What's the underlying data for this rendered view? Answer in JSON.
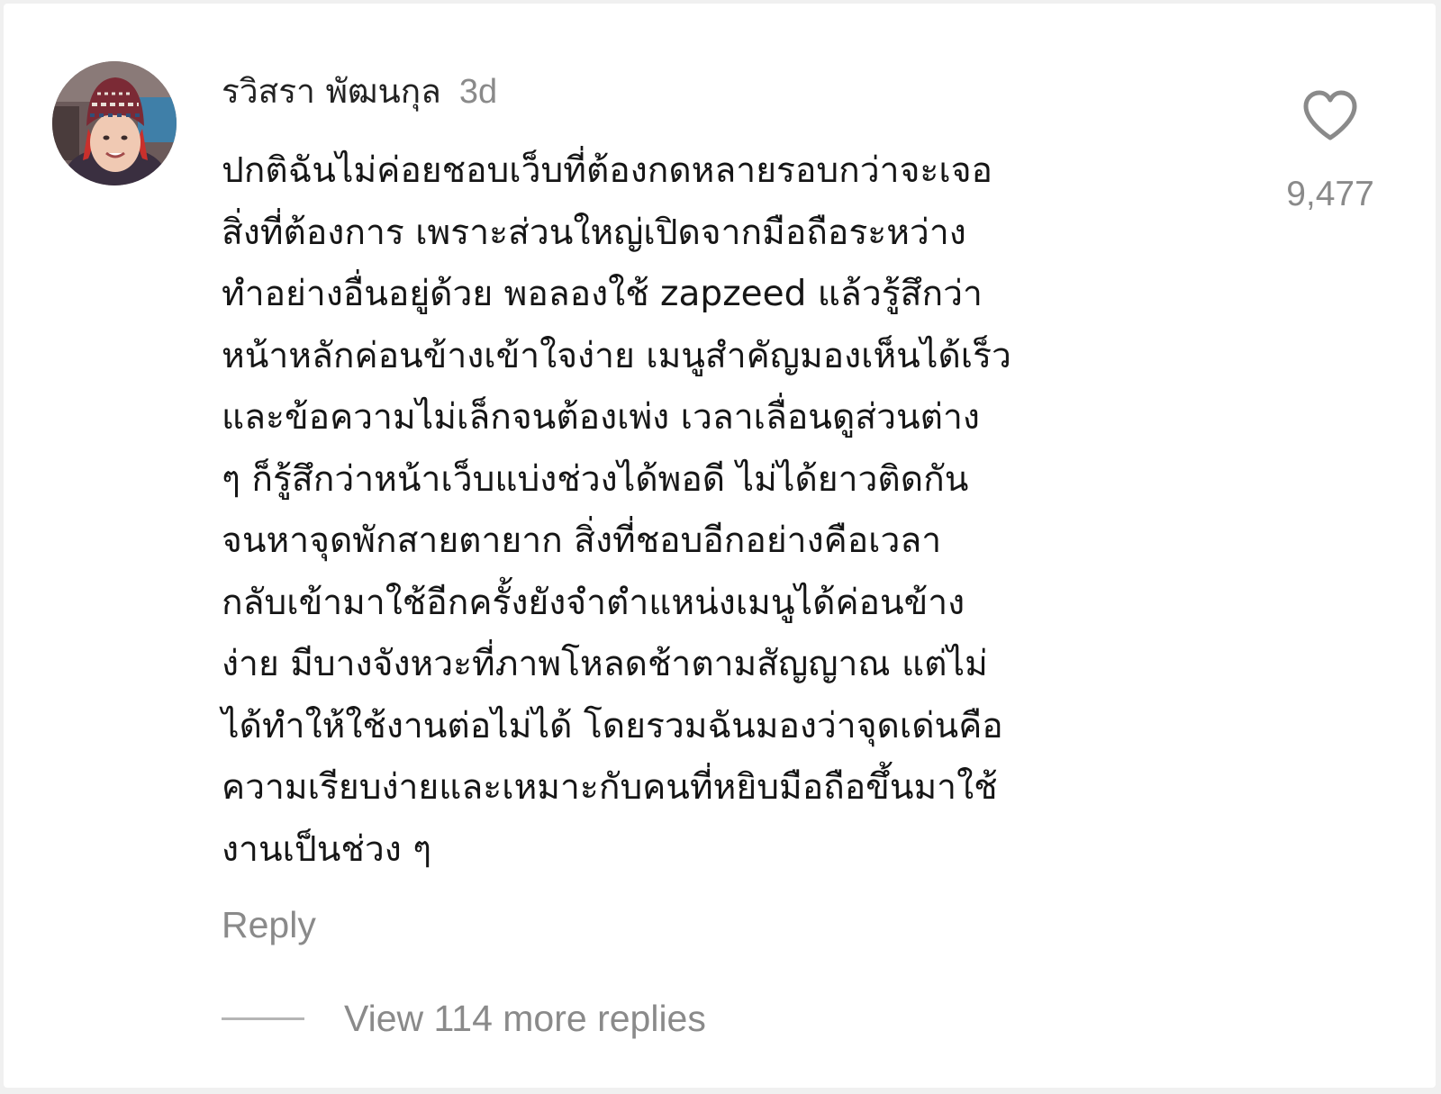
{
  "comment": {
    "author": "รวิสรา พัฒนกุล",
    "timestamp": "3d",
    "avatar": "profile-photo",
    "body_lines": [
      "ปกติฉันไม่ค่อยชอบเว็บที่ต้องกดหลายรอบกว่าจะเจอ",
      "สิ่งที่ต้องการ เพราะส่วนใหญ่เปิดจากมือถือระหว่าง",
      "ทำอย่างอื่นอยู่ด้วย พอลองใช้ zapzeed แล้วรู้สึกว่า",
      "หน้าหลักค่อนข้างเข้าใจง่าย เมนูสำคัญมองเห็นได้เร็ว",
      "และข้อความไม่เล็กจนต้องเพ่ง เวลาเลื่อนดูส่วนต่าง",
      "ๆ ก็รู้สึกว่าหน้าเว็บแบ่งช่วงได้พอดี ไม่ได้ยาวติดกัน",
      "จนหาจุดพักสายตายาก สิ่งที่ชอบอีกอย่างคือเวลา",
      "กลับเข้ามาใช้อีกครั้งยังจำตำแหน่งเมนูได้ค่อนข้าง",
      "ง่าย มีบางจังหวะที่ภาพโหลดช้าตามสัญญาณ แต่ไม่",
      "ได้ทำให้ใช้งานต่อไม่ได้ โดยรวมฉันมองว่าจุดเด่นคือ",
      "ความเรียบง่ายและเหมาะกับคนที่หยิบมือถือขึ้นมาใช้",
      "งานเป็นช่วง ๆ"
    ],
    "like_icon": "heart-outline-icon",
    "like_count": "9,477",
    "reply_label": "Reply",
    "view_replies_label": "View 114 more replies"
  },
  "colors": {
    "text_primary": "#161616",
    "text_secondary": "#8a8a8a",
    "background": "#ffffff"
  }
}
